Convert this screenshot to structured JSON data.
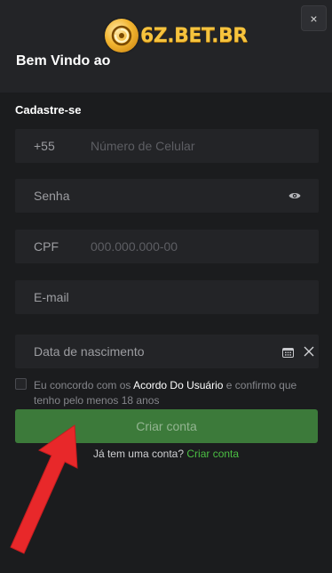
{
  "header": {
    "logo_text": "6Z.BET.BR",
    "logo_glyph": "◎",
    "close_label": "×",
    "welcome": "Bem Vindo ao"
  },
  "form": {
    "section_title": "Cadastre-se",
    "phone": {
      "prefix": "+55",
      "placeholder": "Número de Celular"
    },
    "password": {
      "label": "Senha",
      "icon": "eye-icon"
    },
    "cpf": {
      "prefix": "CPF",
      "placeholder": "000.000.000-00"
    },
    "email": {
      "label": "E-mail"
    },
    "birth": {
      "label": "Data de nascimento",
      "icons": [
        "calendar-icon",
        "clear-icon"
      ]
    },
    "agree": {
      "text_before": "Eu concordo com os ",
      "link": "Acordo Do Usuário",
      "text_after": " e confirmo que tenho pelo menos 18 anos",
      "checked": false
    },
    "submit_label": "Criar conta",
    "login_prompt": "Já tem uma conta?",
    "login_link": "Criar conta"
  },
  "colors": {
    "background": "#1b1c1e",
    "field": "#232427",
    "accent_green": "#4bbf43",
    "button_green": "#3c7a3a",
    "arrow_red": "#e8282a",
    "logo_gold": "#f5c33e"
  }
}
